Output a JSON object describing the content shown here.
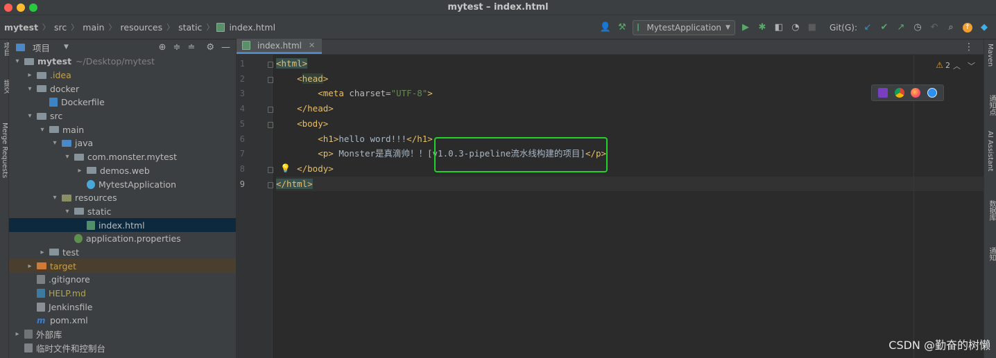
{
  "window": {
    "title": "mytest – index.html"
  },
  "breadcrumbs": [
    "mytest",
    "src",
    "main",
    "resources",
    "static",
    "index.html"
  ],
  "toolbar": {
    "run_config": "MytestApplication",
    "git_label": "Git(G):"
  },
  "project_panel": {
    "title": "项目",
    "tree": [
      {
        "label": "mytest",
        "hint": "~/Desktop/mytest",
        "depth": 0,
        "arrow": "▾",
        "icon": "folder",
        "kind": "root"
      },
      {
        "label": ".idea",
        "depth": 1,
        "arrow": "▸",
        "icon": "folder",
        "kind": "idea"
      },
      {
        "label": "docker",
        "depth": 1,
        "arrow": "▾",
        "icon": "folder"
      },
      {
        "label": "Dockerfile",
        "depth": 2,
        "arrow": "",
        "icon": "docker"
      },
      {
        "label": "src",
        "depth": 1,
        "arrow": "▾",
        "icon": "folder"
      },
      {
        "label": "main",
        "depth": 2,
        "arrow": "▾",
        "icon": "folder"
      },
      {
        "label": "java",
        "depth": 3,
        "arrow": "▾",
        "icon": "folder-blue"
      },
      {
        "label": "com.monster.mytest",
        "depth": 4,
        "arrow": "▾",
        "icon": "folder"
      },
      {
        "label": "demos.web",
        "depth": 5,
        "arrow": "▸",
        "icon": "folder"
      },
      {
        "label": "MytestApplication",
        "depth": 5,
        "arrow": "",
        "icon": "app"
      },
      {
        "label": "resources",
        "depth": 3,
        "arrow": "▾",
        "icon": "folder-res"
      },
      {
        "label": "static",
        "depth": 4,
        "arrow": "▾",
        "icon": "folder"
      },
      {
        "label": "index.html",
        "depth": 5,
        "arrow": "",
        "icon": "html",
        "kind": "selected"
      },
      {
        "label": "application.properties",
        "depth": 4,
        "arrow": "",
        "icon": "prop"
      },
      {
        "label": "test",
        "depth": 2,
        "arrow": "▸",
        "icon": "folder"
      },
      {
        "label": "target",
        "depth": 1,
        "arrow": "▸",
        "icon": "folder-orange",
        "kind": "target"
      },
      {
        "label": ".gitignore",
        "depth": 1,
        "arrow": "",
        "icon": "git"
      },
      {
        "label": "HELP.md",
        "depth": 1,
        "arrow": "",
        "icon": "md",
        "kind": "md"
      },
      {
        "label": "Jenkinsfile",
        "depth": 1,
        "arrow": "",
        "icon": "jenk"
      },
      {
        "label": "pom.xml",
        "depth": 1,
        "arrow": "",
        "icon": "maven"
      },
      {
        "label": "外部库",
        "depth": 0,
        "arrow": "▸",
        "icon": "lib"
      },
      {
        "label": "临时文件和控制台",
        "depth": 0,
        "arrow": "",
        "icon": "scratch"
      }
    ]
  },
  "left_strip_labels": [
    "项目",
    "提交",
    "Merge Requests"
  ],
  "right_strip_labels": [
    "Maven",
    "通知点",
    "AI Assistant",
    "数据库",
    "通知"
  ],
  "editor": {
    "tab": "index.html",
    "warnings_count": "2",
    "line_numbers": [
      "1",
      "2",
      "3",
      "4",
      "5",
      "6",
      "7",
      "8",
      "9"
    ],
    "current_line": 9,
    "lines": [
      [
        {
          "c": "tag hl",
          "t": "<html>"
        }
      ],
      [
        {
          "c": "sp",
          "t": "    "
        },
        {
          "c": "tag",
          "t": "<"
        },
        {
          "c": "tag hl2",
          "t": "head"
        },
        {
          "c": "tag",
          "t": ">"
        }
      ],
      [
        {
          "c": "sp",
          "t": "        "
        },
        {
          "c": "tag",
          "t": "<meta "
        },
        {
          "c": "attr",
          "t": "charset="
        },
        {
          "c": "str",
          "t": "\"UTF-8\""
        },
        {
          "c": "tag",
          "t": ">"
        }
      ],
      [
        {
          "c": "sp",
          "t": "    "
        },
        {
          "c": "tag",
          "t": "</head>"
        }
      ],
      [
        {
          "c": "sp",
          "t": "    "
        },
        {
          "c": "tag",
          "t": "<body>"
        }
      ],
      [
        {
          "c": "sp",
          "t": "        "
        },
        {
          "c": "tag",
          "t": "<h1>"
        },
        {
          "c": "txt",
          "t": "hello word!!!"
        },
        {
          "c": "tag",
          "t": "</h1>"
        }
      ],
      [
        {
          "c": "sp",
          "t": "        "
        },
        {
          "c": "tag",
          "t": "<p>"
        },
        {
          "c": "txt",
          "t": " Monster是真滴帅！！[v1.0.3-pipeline流水线构建的项目]"
        },
        {
          "c": "tag",
          "t": "</p>"
        }
      ],
      [
        {
          "c": "sp",
          "t": "    "
        },
        {
          "c": "tag",
          "t": "</body>"
        }
      ],
      [
        {
          "c": "tag hl",
          "t": "</html>"
        }
      ]
    ]
  },
  "watermark": "CSDN @勤奋的树懒"
}
